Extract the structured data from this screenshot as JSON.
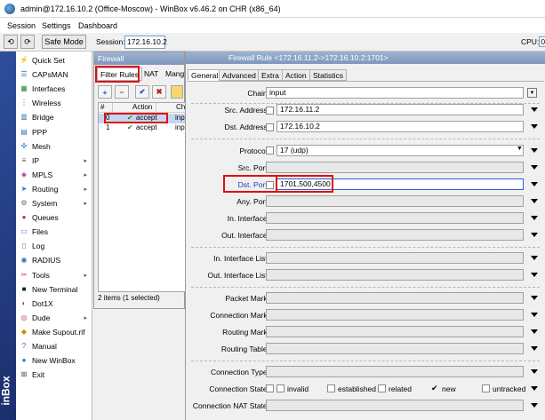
{
  "window": {
    "title": "admin@172.16.10.2 (Office-Moscow) - WinBox v6.46.2 on CHR (x86_64)"
  },
  "menubar": [
    "Session",
    "Settings",
    "Dashboard"
  ],
  "toolbar": {
    "undo": "⟲",
    "redo": "⟳",
    "safe_mode": "Safe Mode",
    "session_label": "Session:",
    "session_value": "172.16.10.2",
    "cpu_label": "CPU:",
    "cpu_value": "0"
  },
  "strip": {
    "text": "inBox"
  },
  "nav": [
    {
      "label": "Quick Set",
      "icon": "quick-set-icon",
      "glyph": "⚡",
      "color": "#d08a00",
      "arrow": false
    },
    {
      "label": "CAPsMAN",
      "icon": "capsman-icon",
      "glyph": "☰",
      "color": "#3a6ea5",
      "arrow": false
    },
    {
      "label": "Interfaces",
      "icon": "interfaces-icon",
      "glyph": "▦",
      "color": "#2f8a2f",
      "arrow": false
    },
    {
      "label": "Wireless",
      "icon": "wireless-icon",
      "glyph": "⋮",
      "color": "#555",
      "arrow": false
    },
    {
      "label": "Bridge",
      "icon": "bridge-icon",
      "glyph": "▥",
      "color": "#3a6ea5",
      "arrow": false
    },
    {
      "label": "PPP",
      "icon": "ppp-icon",
      "glyph": "▤",
      "color": "#2f6fbf",
      "arrow": false
    },
    {
      "label": "Mesh",
      "icon": "mesh-icon",
      "glyph": "✣",
      "color": "#2f6fbf",
      "arrow": false
    },
    {
      "label": "IP",
      "icon": "ip-icon",
      "glyph": "≡",
      "color": "#555",
      "arrow": true
    },
    {
      "label": "MPLS",
      "icon": "mpls-icon",
      "glyph": "◈",
      "color": "#8a2f8a",
      "arrow": true
    },
    {
      "label": "Routing",
      "icon": "routing-icon",
      "glyph": "➤",
      "color": "#2f6fbf",
      "arrow": true
    },
    {
      "label": "System",
      "icon": "system-icon",
      "glyph": "⚙",
      "color": "#666",
      "arrow": true
    },
    {
      "label": "Queues",
      "icon": "queues-icon",
      "glyph": "●",
      "color": "#c03030",
      "arrow": false
    },
    {
      "label": "Files",
      "icon": "files-icon",
      "glyph": "▭",
      "color": "#2f6fbf",
      "arrow": false
    },
    {
      "label": "Log",
      "icon": "log-icon",
      "glyph": "▯",
      "color": "#777",
      "arrow": false
    },
    {
      "label": "RADIUS",
      "icon": "radius-icon",
      "glyph": "◉",
      "color": "#3070c0",
      "arrow": false
    },
    {
      "label": "Tools",
      "icon": "tools-icon",
      "glyph": "✂",
      "color": "#c03030",
      "arrow": true
    },
    {
      "label": "New Terminal",
      "icon": "terminal-icon",
      "glyph": "■",
      "color": "#222",
      "arrow": false
    },
    {
      "label": "Dot1X",
      "icon": "dot1x-icon",
      "glyph": "◐",
      "color": "#c03030",
      "arrow": false
    },
    {
      "label": "Dude",
      "icon": "dude-icon",
      "glyph": "◎",
      "color": "#c03030",
      "arrow": true
    },
    {
      "label": "Make Supout.rif",
      "icon": "supout-icon",
      "glyph": "◆",
      "color": "#d08a00",
      "arrow": false
    },
    {
      "label": "Manual",
      "icon": "manual-icon",
      "glyph": "?",
      "color": "#2f6fbf",
      "arrow": false
    },
    {
      "label": "New WinBox",
      "icon": "winbox-icon",
      "glyph": "●",
      "color": "#2f6fbf",
      "arrow": false
    },
    {
      "label": "Exit",
      "icon": "exit-icon",
      "glyph": "⊠",
      "color": "#555",
      "arrow": false
    }
  ],
  "firewall": {
    "title": "Firewall",
    "tabs": [
      "Filter Rules",
      "NAT",
      "Mang"
    ],
    "buttons": [
      "+",
      "−",
      "✔",
      "✖"
    ],
    "columns": [
      "#",
      "Action",
      "Cha"
    ],
    "rows": [
      {
        "num": "0",
        "action": "accept",
        "chain": "inpu",
        "selected": true
      },
      {
        "num": "1",
        "action": "accept",
        "chain": "inpu",
        "selected": false
      }
    ],
    "status": "2 items (1 selected)"
  },
  "rule": {
    "title": "Firewall Rule <172.16.11.2->172.16.10.2:1701>",
    "tabs": [
      "General",
      "Advanced",
      "Extra",
      "Action",
      "Statistics"
    ],
    "fields": {
      "chain": {
        "label": "Chain:",
        "value": "input"
      },
      "src_address": {
        "label": "Src. Address:",
        "value": "172.16.11.2"
      },
      "dst_address": {
        "label": "Dst. Address:",
        "value": "172.16.10.2"
      },
      "protocol": {
        "label": "Protocol:",
        "value": "17 (udp)"
      },
      "src_port": {
        "label": "Src. Port:"
      },
      "dst_port": {
        "label": "Dst. Port:",
        "value": "1701,500,4500"
      },
      "any_port": {
        "label": "Any. Port:"
      },
      "in_interface": {
        "label": "In. Interface:"
      },
      "out_interface": {
        "label": "Out. Interface:"
      },
      "in_interface_list": {
        "label": "In. Interface List:"
      },
      "out_interface_list": {
        "label": "Out. Interface List:"
      },
      "packet_mark": {
        "label": "Packet Mark:"
      },
      "connection_mark": {
        "label": "Connection Mark:"
      },
      "routing_mark": {
        "label": "Routing Mark:"
      },
      "routing_table": {
        "label": "Routing Table:"
      },
      "connection_type": {
        "label": "Connection Type:"
      },
      "connection_state": {
        "label": "Connection State:"
      },
      "connection_nat_state": {
        "label": "Connection NAT State:"
      }
    },
    "states": [
      {
        "label": "invalid",
        "checked": false
      },
      {
        "label": "established",
        "checked": false
      },
      {
        "label": "related",
        "checked": false
      },
      {
        "label": "new",
        "checked": true
      },
      {
        "label": "untracked",
        "checked": false
      }
    ]
  },
  "highlight_color": "#e01010"
}
